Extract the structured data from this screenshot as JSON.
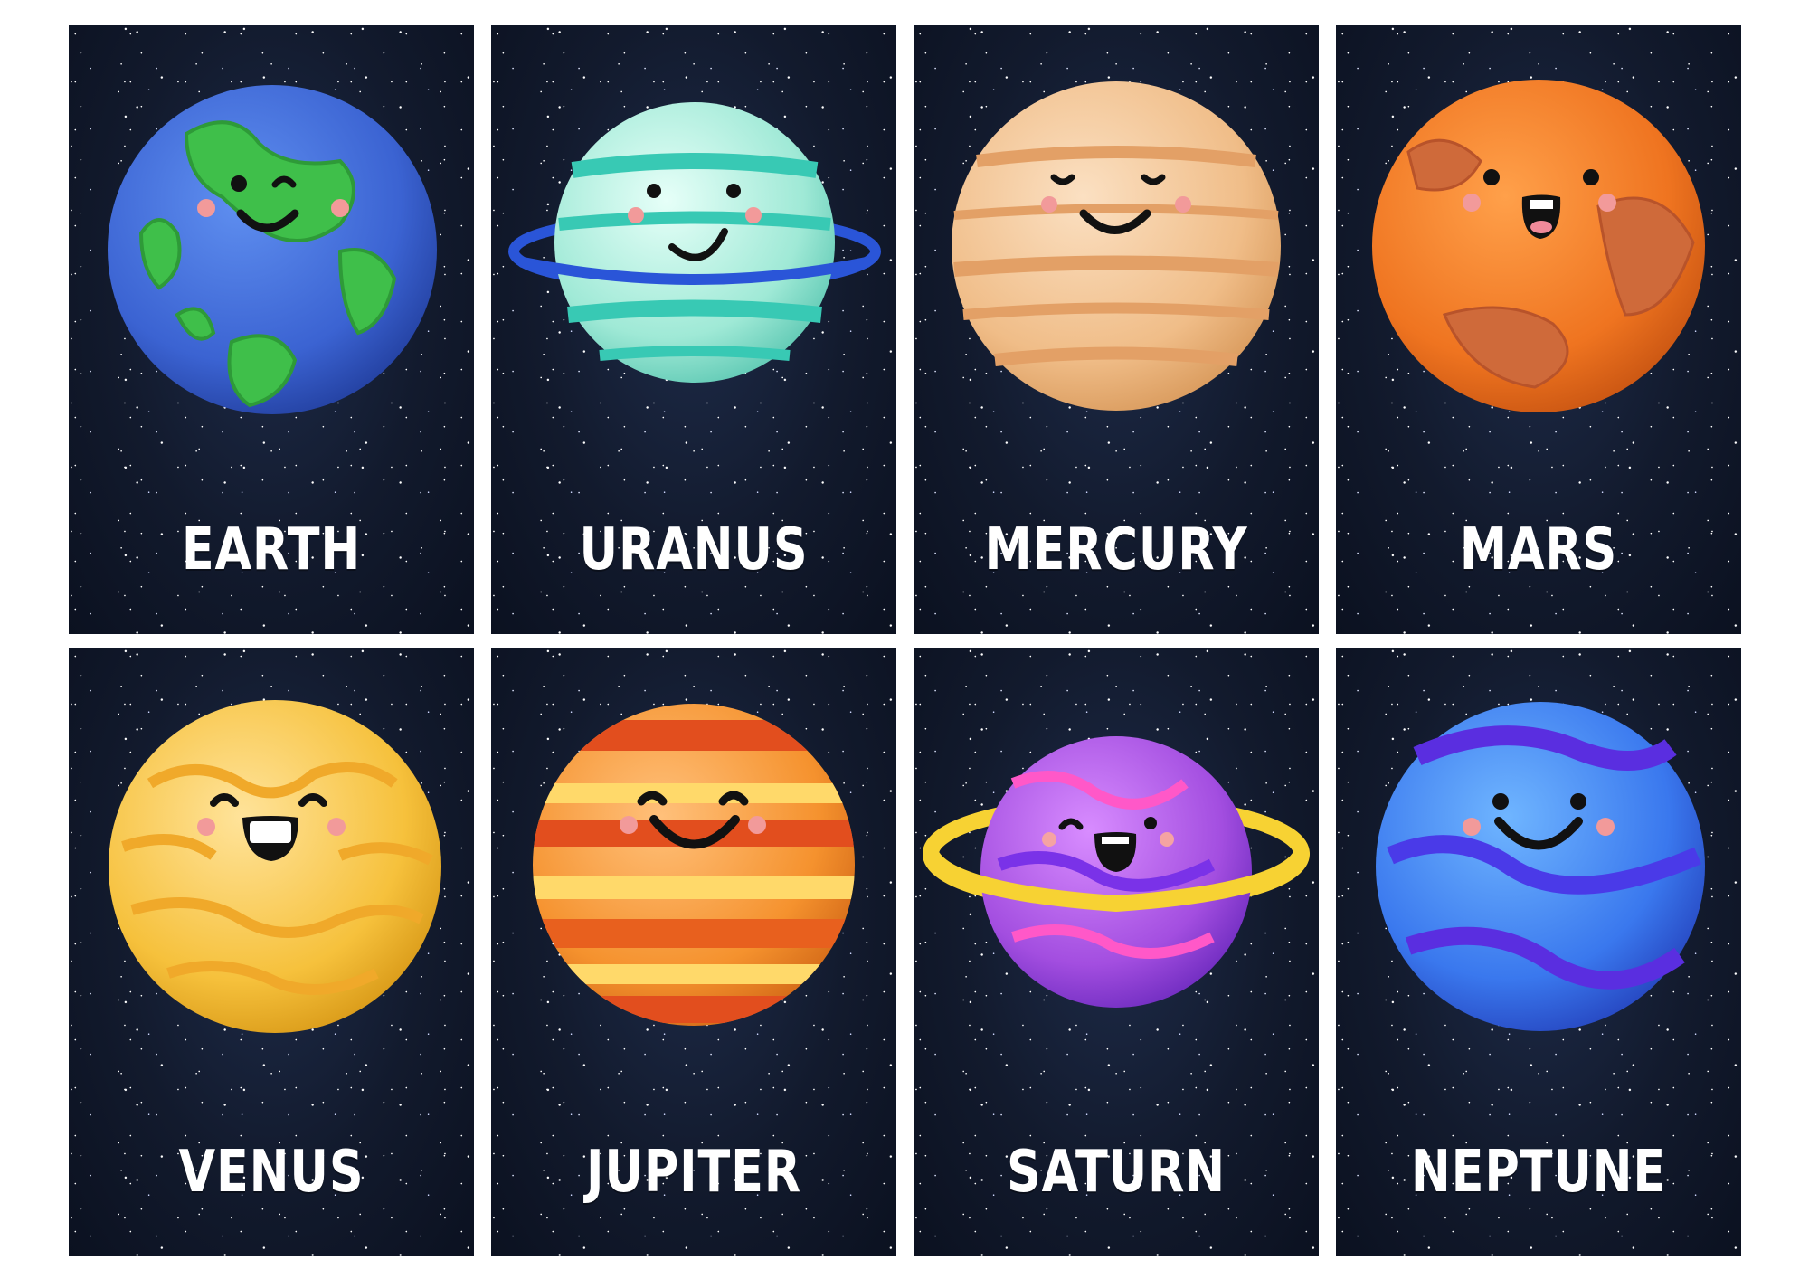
{
  "cards": [
    {
      "label": "EARTH"
    },
    {
      "label": "URANUS"
    },
    {
      "label": "MERCURY"
    },
    {
      "label": "MARS"
    },
    {
      "label": "VENUS"
    },
    {
      "label": "JUPITER"
    },
    {
      "label": "SATURN"
    },
    {
      "label": "NEPTUNE"
    }
  ],
  "colors": {
    "background": "#121a2d",
    "earth": "#3b6ad6",
    "uranus": "#aef0e0",
    "mercury": "#f2c494",
    "mars": "#f07a1e",
    "venus": "#f7c23a",
    "jupiter": "#f58a2a",
    "saturn": "#a24fe0",
    "neptune": "#3b7bf0"
  }
}
